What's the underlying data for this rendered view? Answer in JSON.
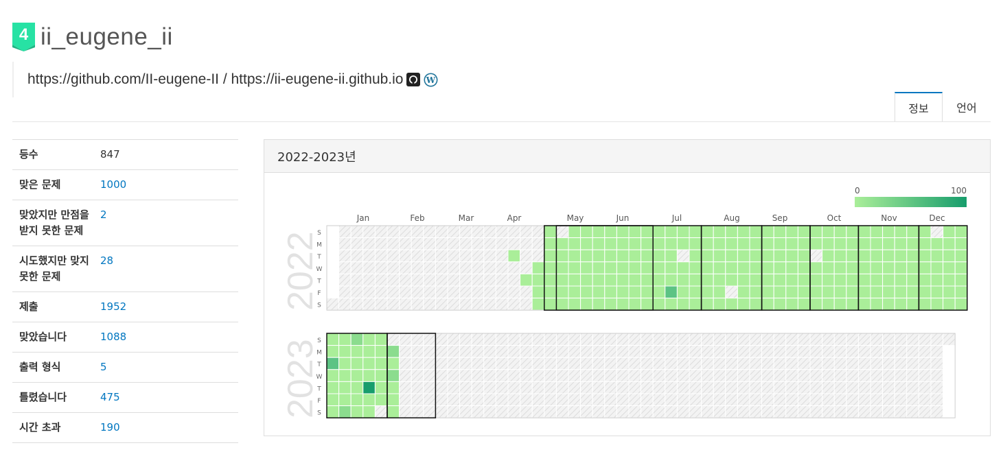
{
  "user": {
    "tier_number": "4",
    "tier_color": "#27e2a4",
    "name": "ii_eugene_ii",
    "bio": "https://github.com/II-eugene-II / https://ii-eugene-ii.github.io",
    "bio_icons": [
      "github-icon",
      "wordpress-icon"
    ]
  },
  "tabs": [
    {
      "label": "정보",
      "active": true
    },
    {
      "label": "언어",
      "active": false
    }
  ],
  "stats": [
    {
      "label": "등수",
      "value": "847",
      "link": false
    },
    {
      "label": "맞은 문제",
      "value": "1000",
      "link": true
    },
    {
      "label": "맞았지만 만점을 받지 못한 문제",
      "value": "2",
      "link": true
    },
    {
      "label": "시도했지만 맞지 못한 문제",
      "value": "28",
      "link": true
    },
    {
      "label": "제출",
      "value": "1952",
      "link": true
    },
    {
      "label": "맞았습니다",
      "value": "1088",
      "link": true
    },
    {
      "label": "출력 형식",
      "value": "5",
      "link": true
    },
    {
      "label": "틀렸습니다",
      "value": "475",
      "link": true
    },
    {
      "label": "시간 초과",
      "value": "190",
      "link": true
    }
  ],
  "panel": {
    "title": "2022-2023년",
    "legend_min": "0",
    "legend_max": "100",
    "months": [
      "Jan",
      "Feb",
      "Mar",
      "Apr",
      "May",
      "Jun",
      "Jul",
      "Aug",
      "Sep",
      "Oct",
      "Nov",
      "Dec"
    ],
    "days": [
      "S",
      "M",
      "T",
      "W",
      "T",
      "F",
      "S"
    ],
    "years": [
      "2022",
      "2023"
    ],
    "colors": {
      "level0": "#eeeeee",
      "level1": "#aaee99",
      "level2": "#8bdc8e",
      "level3": "#5cc384",
      "level4": "#179d6c",
      "empty": "#f0f0f0",
      "highlight_border": "#111111"
    }
  }
}
